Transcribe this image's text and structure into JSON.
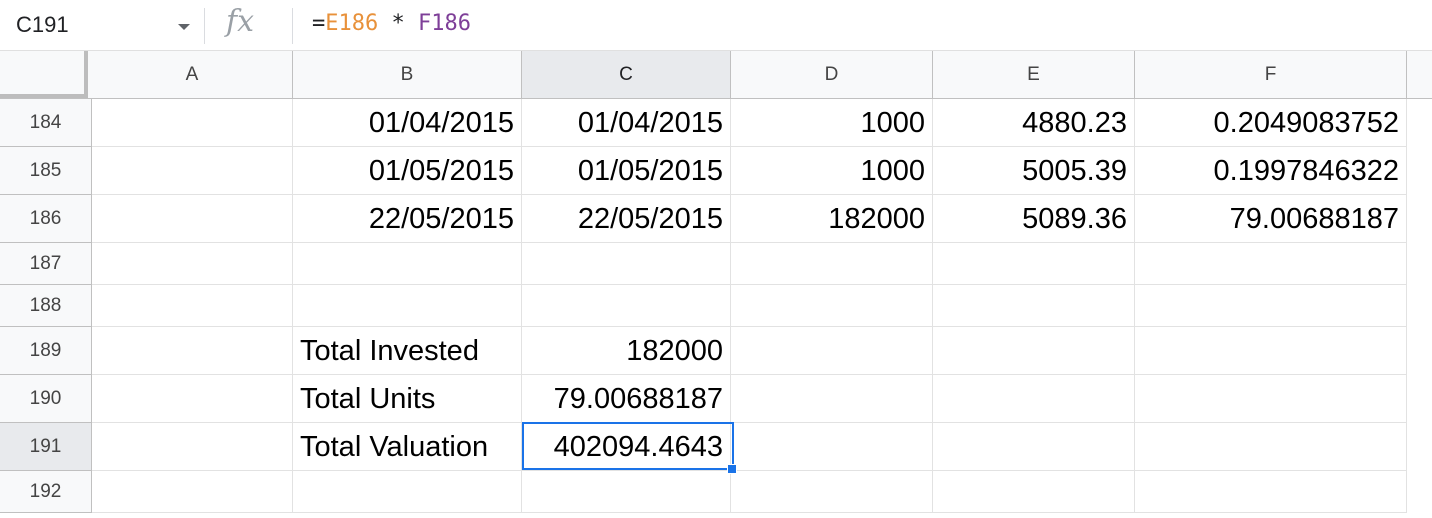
{
  "formula_bar": {
    "name_box": "C191",
    "fx_label": "fx",
    "formula_prefix": "=",
    "ref1": "E186",
    "operator": " * ",
    "ref2": "F186"
  },
  "colors": {
    "ref1": "#e8913a",
    "ref2": "#7e3f98",
    "selection": "#1a73e8"
  },
  "columns": [
    "A",
    "B",
    "C",
    "D",
    "E",
    "F"
  ],
  "selected_column": "C",
  "selected_cell": "C191",
  "rows": [
    {
      "num": "184",
      "cells": [
        "",
        "01/04/2015",
        "01/04/2015",
        "1000",
        "4880.23",
        "0.2049083752"
      ]
    },
    {
      "num": "185",
      "cells": [
        "",
        "01/05/2015",
        "01/05/2015",
        "1000",
        "5005.39",
        "0.1997846322"
      ]
    },
    {
      "num": "186",
      "cells": [
        "",
        "22/05/2015",
        "22/05/2015",
        "182000",
        "5089.36",
        "79.00688187"
      ]
    },
    {
      "num": "187",
      "cells": [
        "",
        "",
        "",
        "",
        "",
        ""
      ]
    },
    {
      "num": "188",
      "cells": [
        "",
        "",
        "",
        "",
        "",
        ""
      ]
    },
    {
      "num": "189",
      "cells": [
        "",
        "Total Invested",
        "182000",
        "",
        "",
        ""
      ]
    },
    {
      "num": "190",
      "cells": [
        "",
        "Total Units",
        "79.00688187",
        "",
        "",
        ""
      ]
    },
    {
      "num": "191",
      "cells": [
        "",
        "Total Valuation",
        "402094.4643",
        "",
        "",
        ""
      ]
    },
    {
      "num": "192",
      "cells": [
        "",
        "",
        "",
        "",
        "",
        ""
      ]
    }
  ]
}
